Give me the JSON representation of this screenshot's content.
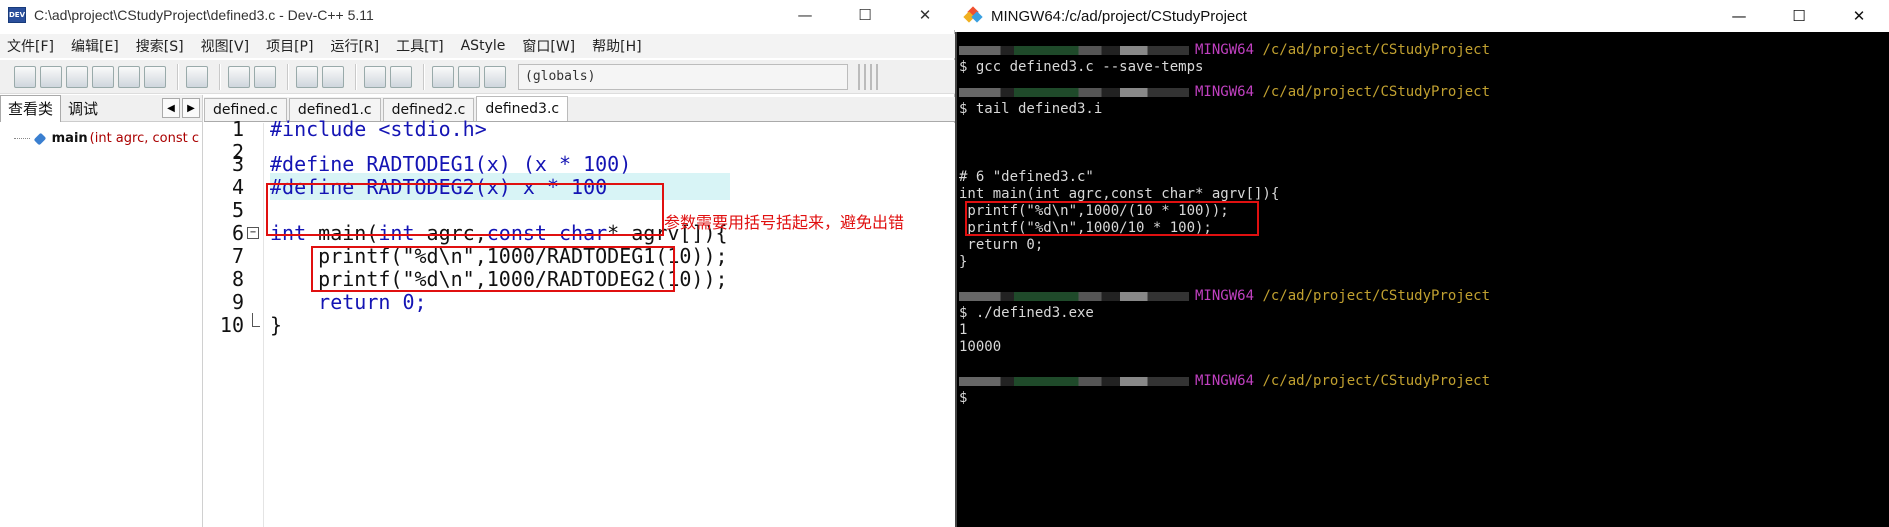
{
  "devcpp": {
    "title": "C:\\ad\\project\\CStudyProject\\defined3.c - Dev-C++ 5.11",
    "app_icon_text": "DEV",
    "window_controls": {
      "minimize": "—",
      "maximize": "☐",
      "close": "✕"
    },
    "menu": [
      "文件[F]",
      "编辑[E]",
      "搜索[S]",
      "视图[V]",
      "项目[P]",
      "运行[R]",
      "工具[T]",
      "AStyle",
      "窗口[W]",
      "帮助[H]"
    ],
    "globals_select": "(globals)",
    "left_panel": {
      "tabs": [
        "查看类",
        "调试"
      ],
      "nav": [
        "◀",
        "▶"
      ],
      "tree_item": {
        "name": "main",
        "signature": "(int agrc, const c"
      }
    },
    "file_tabs": [
      "defined.c",
      "defined1.c",
      "defined2.c",
      "defined3.c"
    ],
    "active_tab": "defined3.c",
    "line_numbers": [
      "1",
      "2",
      "3",
      "4",
      "5",
      "6",
      "7",
      "8",
      "9",
      "10"
    ],
    "code": {
      "l1": "#include <stdio.h>",
      "l2": "",
      "l3": "#define RADTODEG1(x) (x * 100)",
      "l4": "#define RADTODEG2(x) x * 100",
      "l5": "",
      "l6_kw1": "int",
      "l6_a": " main(",
      "l6_kw2": "int",
      "l6_b": " agrc,",
      "l6_kw3": "const char",
      "l6_c": "* agrv[]){",
      "l7": "    printf(\"%d\\n\",1000/RADTODEG1(10));",
      "l8": "    printf(\"%d\\n\",1000/RADTODEG2(10));",
      "l9": "    return 0;",
      "l10": "}"
    },
    "fold_symbol": "−",
    "annotation": "参数需要用括号括起来，避免出错",
    "colors": {
      "directive": "#1414b4",
      "highlight": "#d8f4f6",
      "annotation": "#e01010"
    }
  },
  "terminal": {
    "title": "MINGW64:/c/ad/project/CStudyProject",
    "window_controls": {
      "minimize": "—",
      "maximize": "☐",
      "close": "✕"
    },
    "prompt_env": "MINGW64",
    "prompt_path": "/c/ad/project/CStudyProject",
    "lines": {
      "cmd1": "$ gcc defined3.c --save-temps",
      "cmd2": "$ tail defined3.i",
      "out1": "# 6 \"defined3.c\"",
      "out2": "int main(int agrc,const char* agrv[]){",
      "out3": " printf(\"%d\\n\",1000/(10 * 100));",
      "out4": " printf(\"%d\\n\",1000/10 * 100);",
      "out5": " return 0;",
      "out6": "}",
      "cmd3": "$ ./defined3.exe",
      "res1": "1",
      "res2": "10000",
      "cmd4": "$"
    },
    "colors": {
      "prompt_env": "#c040c0",
      "prompt_path": "#c0a030",
      "background": "#000000"
    }
  }
}
